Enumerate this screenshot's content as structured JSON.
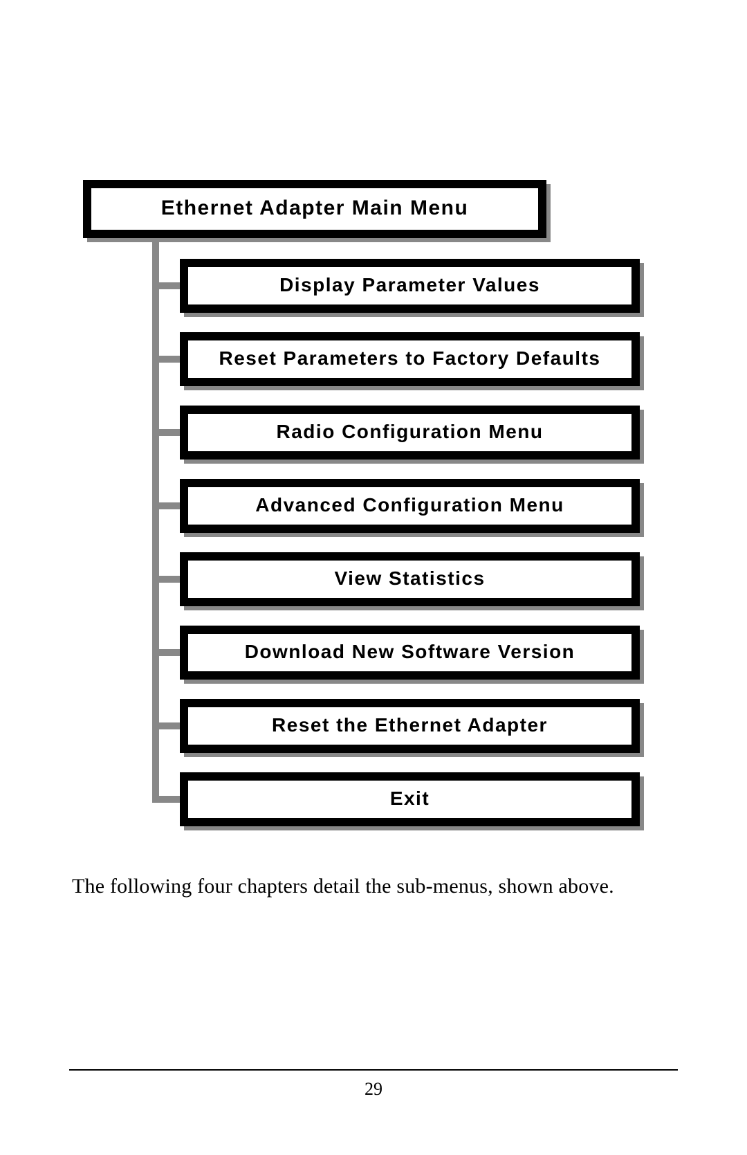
{
  "menu": {
    "title": "Ethernet Adapter Main Menu",
    "items": [
      "Display Parameter Values",
      "Reset Parameters to Factory Defaults",
      "Radio Configuration Menu",
      "Advanced Configuration Menu",
      "View Statistics",
      "Download New Software Version",
      "Reset the Ethernet Adapter",
      "Exit"
    ]
  },
  "body": {
    "paragraph": "The following four chapters detail the sub-menus, shown above."
  },
  "footer": {
    "page_number": "29"
  }
}
